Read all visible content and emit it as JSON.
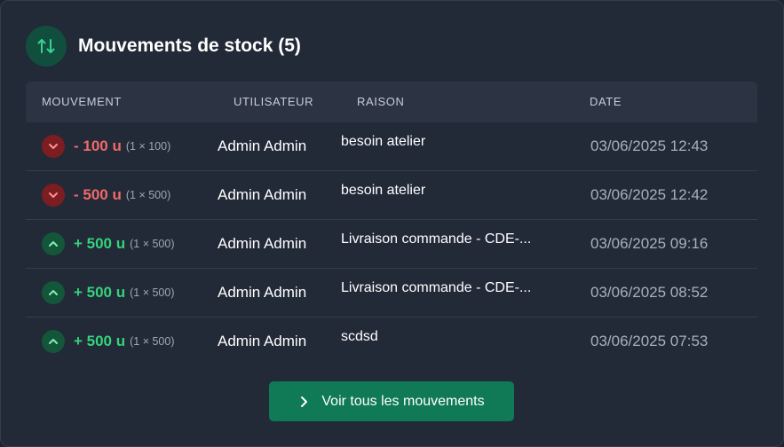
{
  "card": {
    "title": "Mouvements de stock (5)",
    "header_icon": "arrows-up-down-icon"
  },
  "table": {
    "columns": [
      "MOUVEMENT",
      "UTILISATEUR",
      "RAISON",
      "DATE"
    ],
    "rows": [
      {
        "direction": "out",
        "icon": "chevron-down-icon",
        "qty": "- 100 u",
        "detail": "(1 × 100)",
        "user": "Admin Admin",
        "reason": "besoin atelier",
        "date": "03/06/2025 12:43"
      },
      {
        "direction": "out",
        "icon": "chevron-down-icon",
        "qty": "- 500 u",
        "detail": "(1 × 500)",
        "user": "Admin Admin",
        "reason": "besoin atelier",
        "date": "03/06/2025 12:42"
      },
      {
        "direction": "in",
        "icon": "chevron-up-icon",
        "qty": "+ 500 u",
        "detail": "(1 × 500)",
        "user": "Admin Admin",
        "reason": "Livraison commande - CDE-...",
        "date": "03/06/2025 09:16"
      },
      {
        "direction": "in",
        "icon": "chevron-up-icon",
        "qty": "+ 500 u",
        "detail": "(1 × 500)",
        "user": "Admin Admin",
        "reason": "Livraison commande - CDE-...",
        "date": "03/06/2025 08:52"
      },
      {
        "direction": "in",
        "icon": "chevron-up-icon",
        "qty": "+ 500 u",
        "detail": "(1 × 500)",
        "user": "Admin Admin",
        "reason": "scdsd",
        "date": "03/06/2025 07:53"
      }
    ]
  },
  "footer": {
    "button_label": "Voir tous les mouvements",
    "button_icon": "chevron-right-icon"
  },
  "colors": {
    "card_bg": "#222937",
    "out": "#f06a6a",
    "in": "#34d37b",
    "button": "#0f7a55"
  }
}
